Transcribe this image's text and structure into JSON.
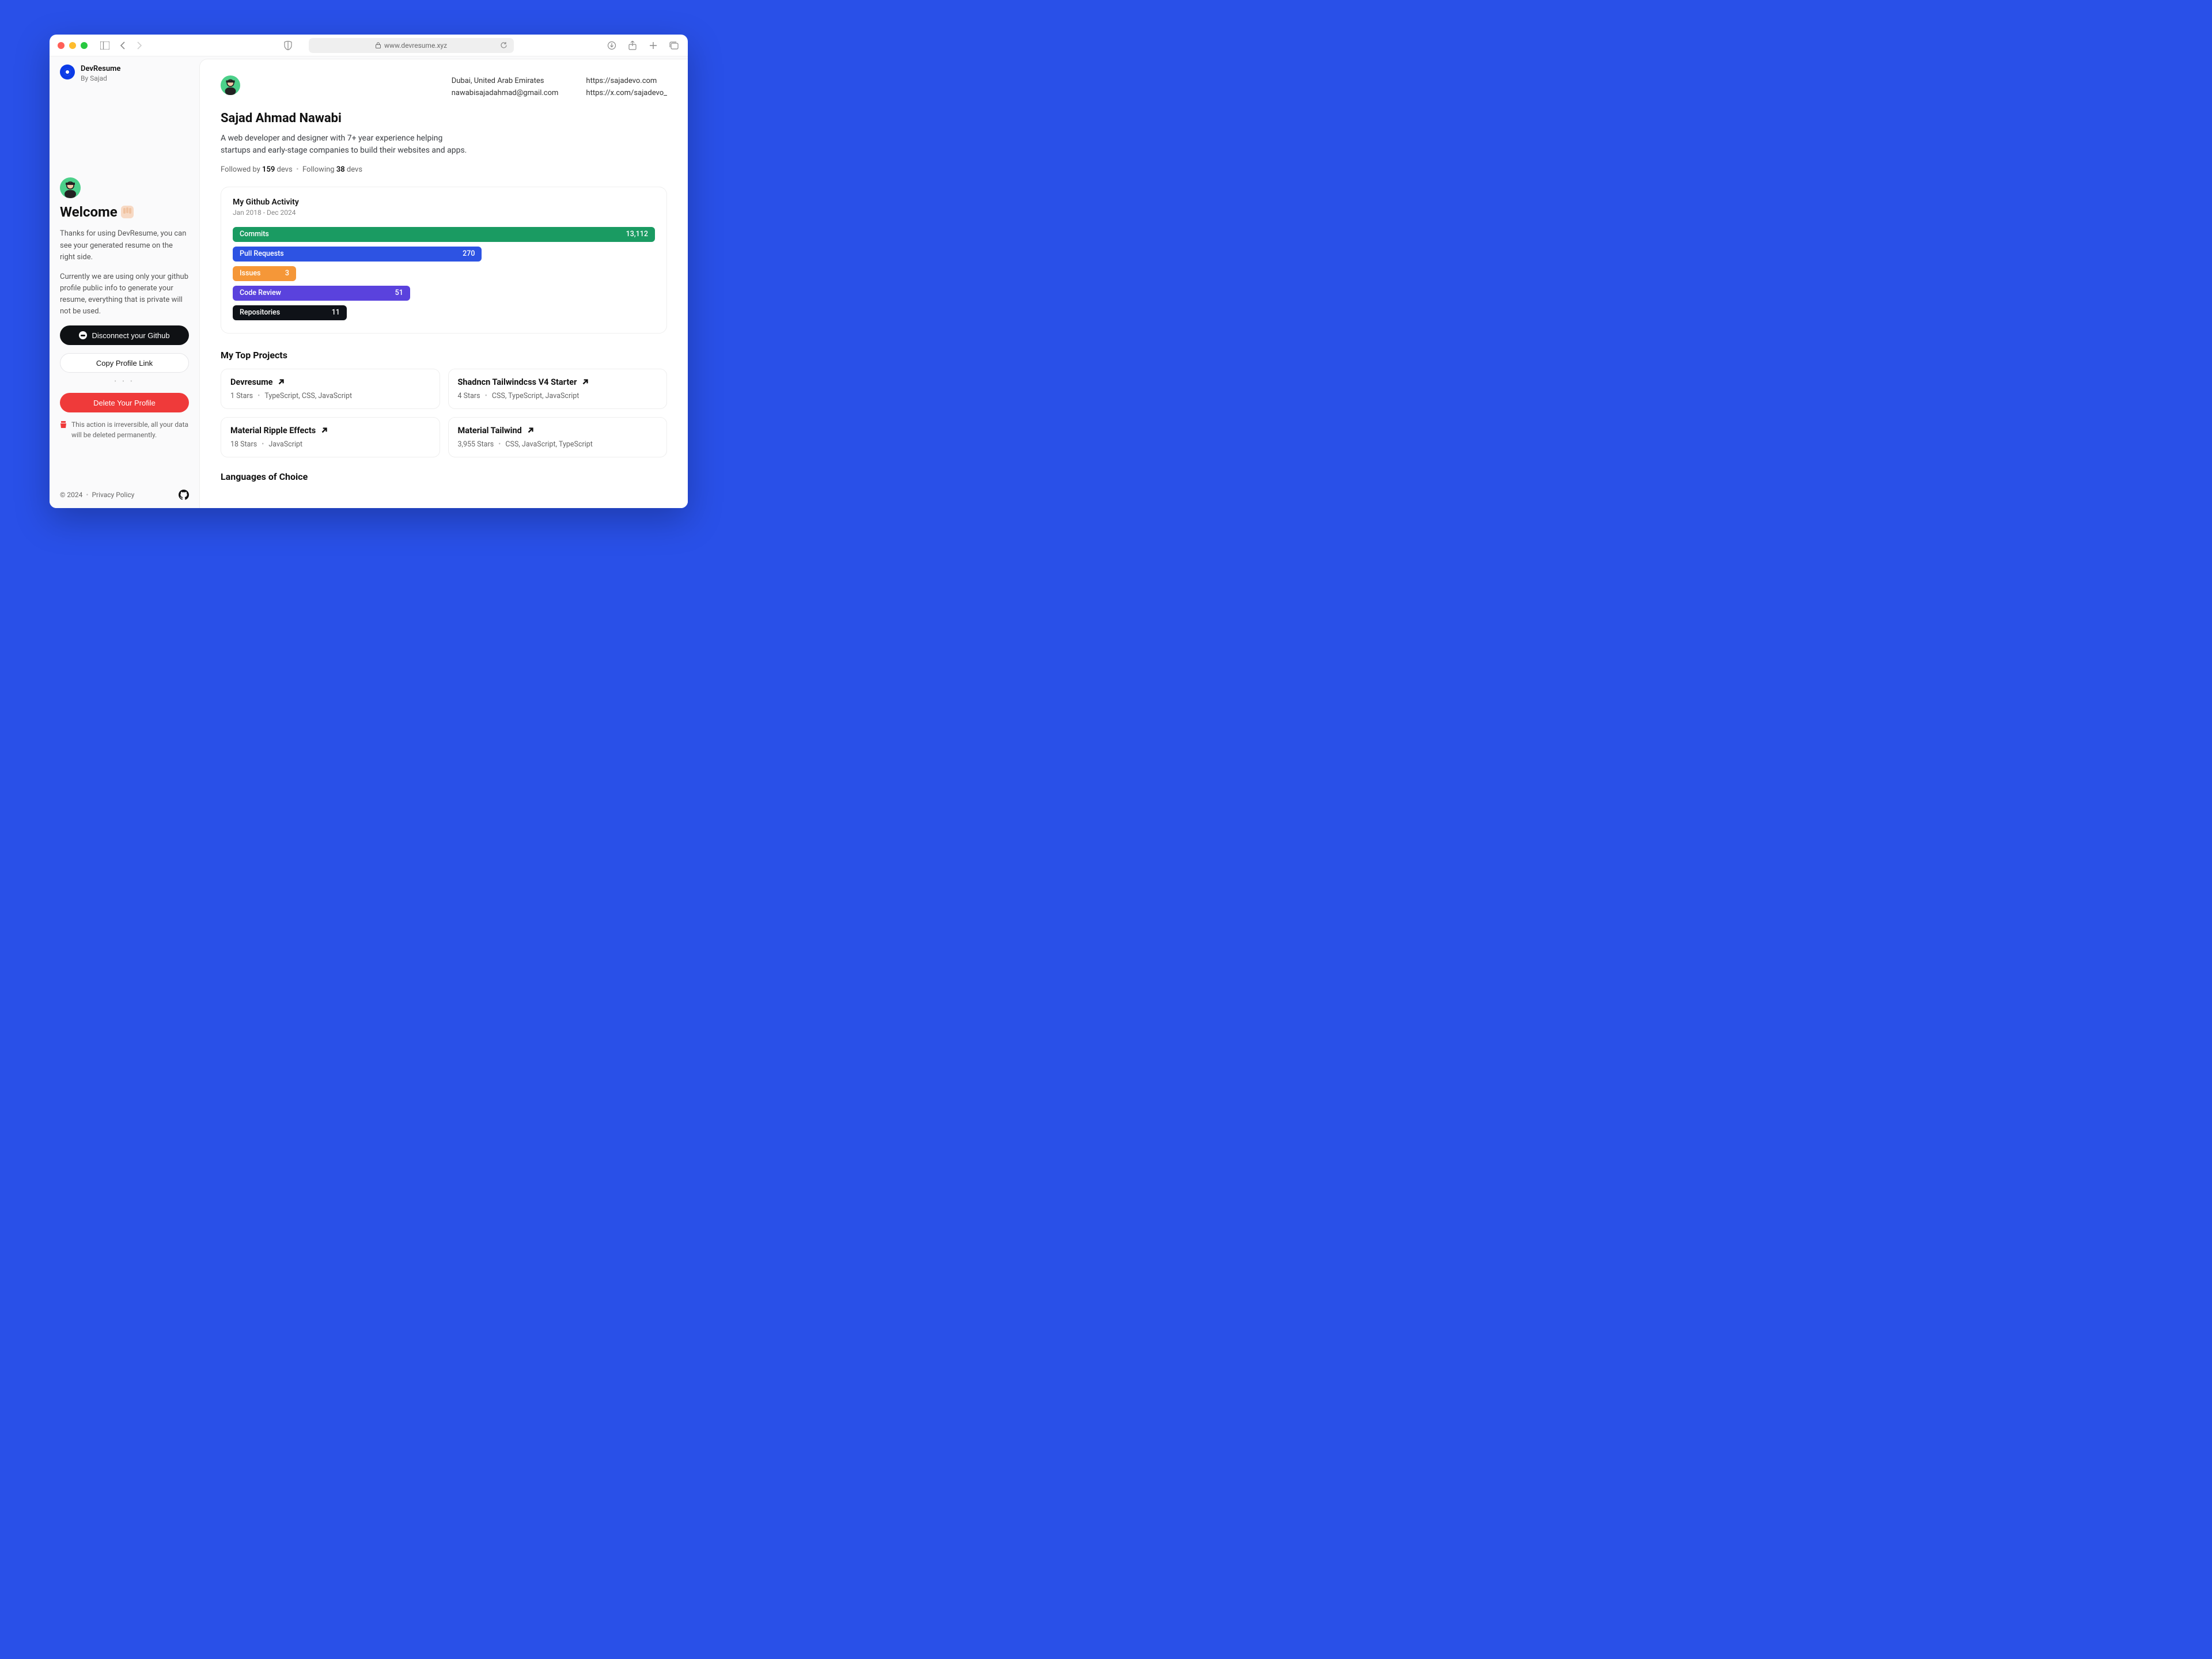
{
  "browser": {
    "url": "www.devresume.xyz"
  },
  "brand": {
    "name": "DevResume",
    "byline": "By Sajad"
  },
  "sidebar": {
    "welcome": "Welcome",
    "para1": "Thanks for using DevResume, you can see your generated resume on the right side.",
    "para2": "Currently we are using only your github profile public info to generate your resume, everything that is private will not be used.",
    "disconnect_label": "Disconnect your Github",
    "copy_label": "Copy Profile Link",
    "delete_label": "Delete Your Profile",
    "warning": "This action is irreversible, all your data will be deleted permanently."
  },
  "footer": {
    "copyright": "© 2024",
    "privacy": "Privacy Policy"
  },
  "profile": {
    "name": "Sajad Ahmad Nawabi",
    "bio": "A web developer and designer with 7+ year experience helping startups and early-stage companies to build their websites and apps.",
    "location": "Dubai, United Arab Emirates",
    "email": "nawabisajadahmad@gmail.com",
    "website": "https://sajadevo.com",
    "twitter": "https://x.com/sajadevo_",
    "followed_by_prefix": "Followed by ",
    "followed_by_count": "159",
    "followed_by_suffix": " devs",
    "following_prefix": "Following ",
    "following_count": "38",
    "following_suffix": " devs"
  },
  "activity": {
    "title": "My Github Activity",
    "range": "Jan 2018 - Dec 2024",
    "bars": {
      "commits": {
        "label": "Commits",
        "value": "13,112"
      },
      "prs": {
        "label": "Pull Requests",
        "value": "270"
      },
      "issues": {
        "label": "Issues",
        "value": "3"
      },
      "code_review": {
        "label": "Code Review",
        "value": "51"
      },
      "repos": {
        "label": "Repositories",
        "value": "11"
      }
    }
  },
  "projects": {
    "title": "My Top Projects",
    "items": [
      {
        "name": "Devresume",
        "stars": "1 Stars",
        "langs": "TypeScript, CSS, JavaScript"
      },
      {
        "name": "Shadncn Tailwindcss V4 Starter",
        "stars": "4 Stars",
        "langs": "CSS, TypeScript, JavaScript"
      },
      {
        "name": "Material Ripple Effects",
        "stars": "18 Stars",
        "langs": "JavaScript"
      },
      {
        "name": "Material Tailwind",
        "stars": "3,955 Stars",
        "langs": "CSS, JavaScript, TypeScript"
      }
    ]
  },
  "languages": {
    "title": "Languages of Choice"
  }
}
